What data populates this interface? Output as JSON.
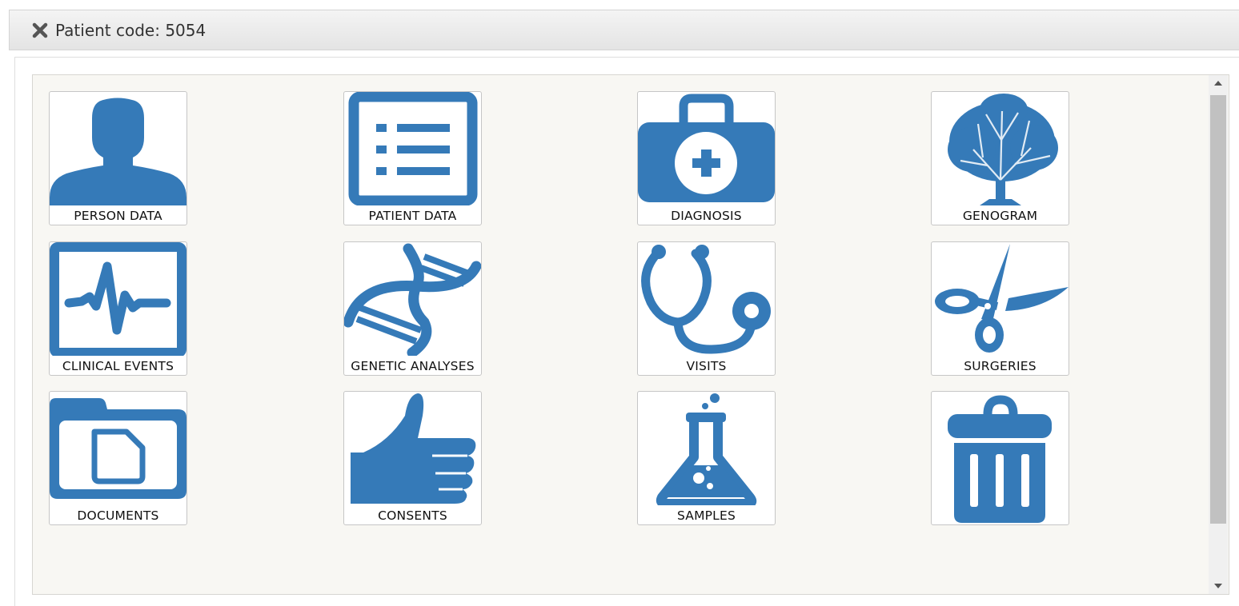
{
  "header": {
    "title": "Patient code: 5054"
  },
  "tiles": [
    {
      "label": "PERSON DATA",
      "icon": "person-icon"
    },
    {
      "label": "PATIENT DATA",
      "icon": "list-document-icon"
    },
    {
      "label": "DIAGNOSIS",
      "icon": "medical-kit-icon"
    },
    {
      "label": "GENOGRAM",
      "icon": "tree-icon"
    },
    {
      "label": "CLINICAL EVENTS",
      "icon": "heartbeat-monitor-icon"
    },
    {
      "label": "GENETIC ANALYSES",
      "icon": "dna-icon"
    },
    {
      "label": "VISITS",
      "icon": "stethoscope-icon"
    },
    {
      "label": "SURGERIES",
      "icon": "scissors-icon"
    },
    {
      "label": "DOCUMENTS",
      "icon": "folder-document-icon"
    },
    {
      "label": "CONSENTS",
      "icon": "thumbs-up-icon"
    },
    {
      "label": "SAMPLES",
      "icon": "flask-icon"
    },
    {
      "label": "",
      "icon": "trash-icon"
    }
  ],
  "colors": {
    "icon_blue": "#357ab8",
    "header_bg": "#ebebeb",
    "panel_bg": "#f8f7f3"
  }
}
